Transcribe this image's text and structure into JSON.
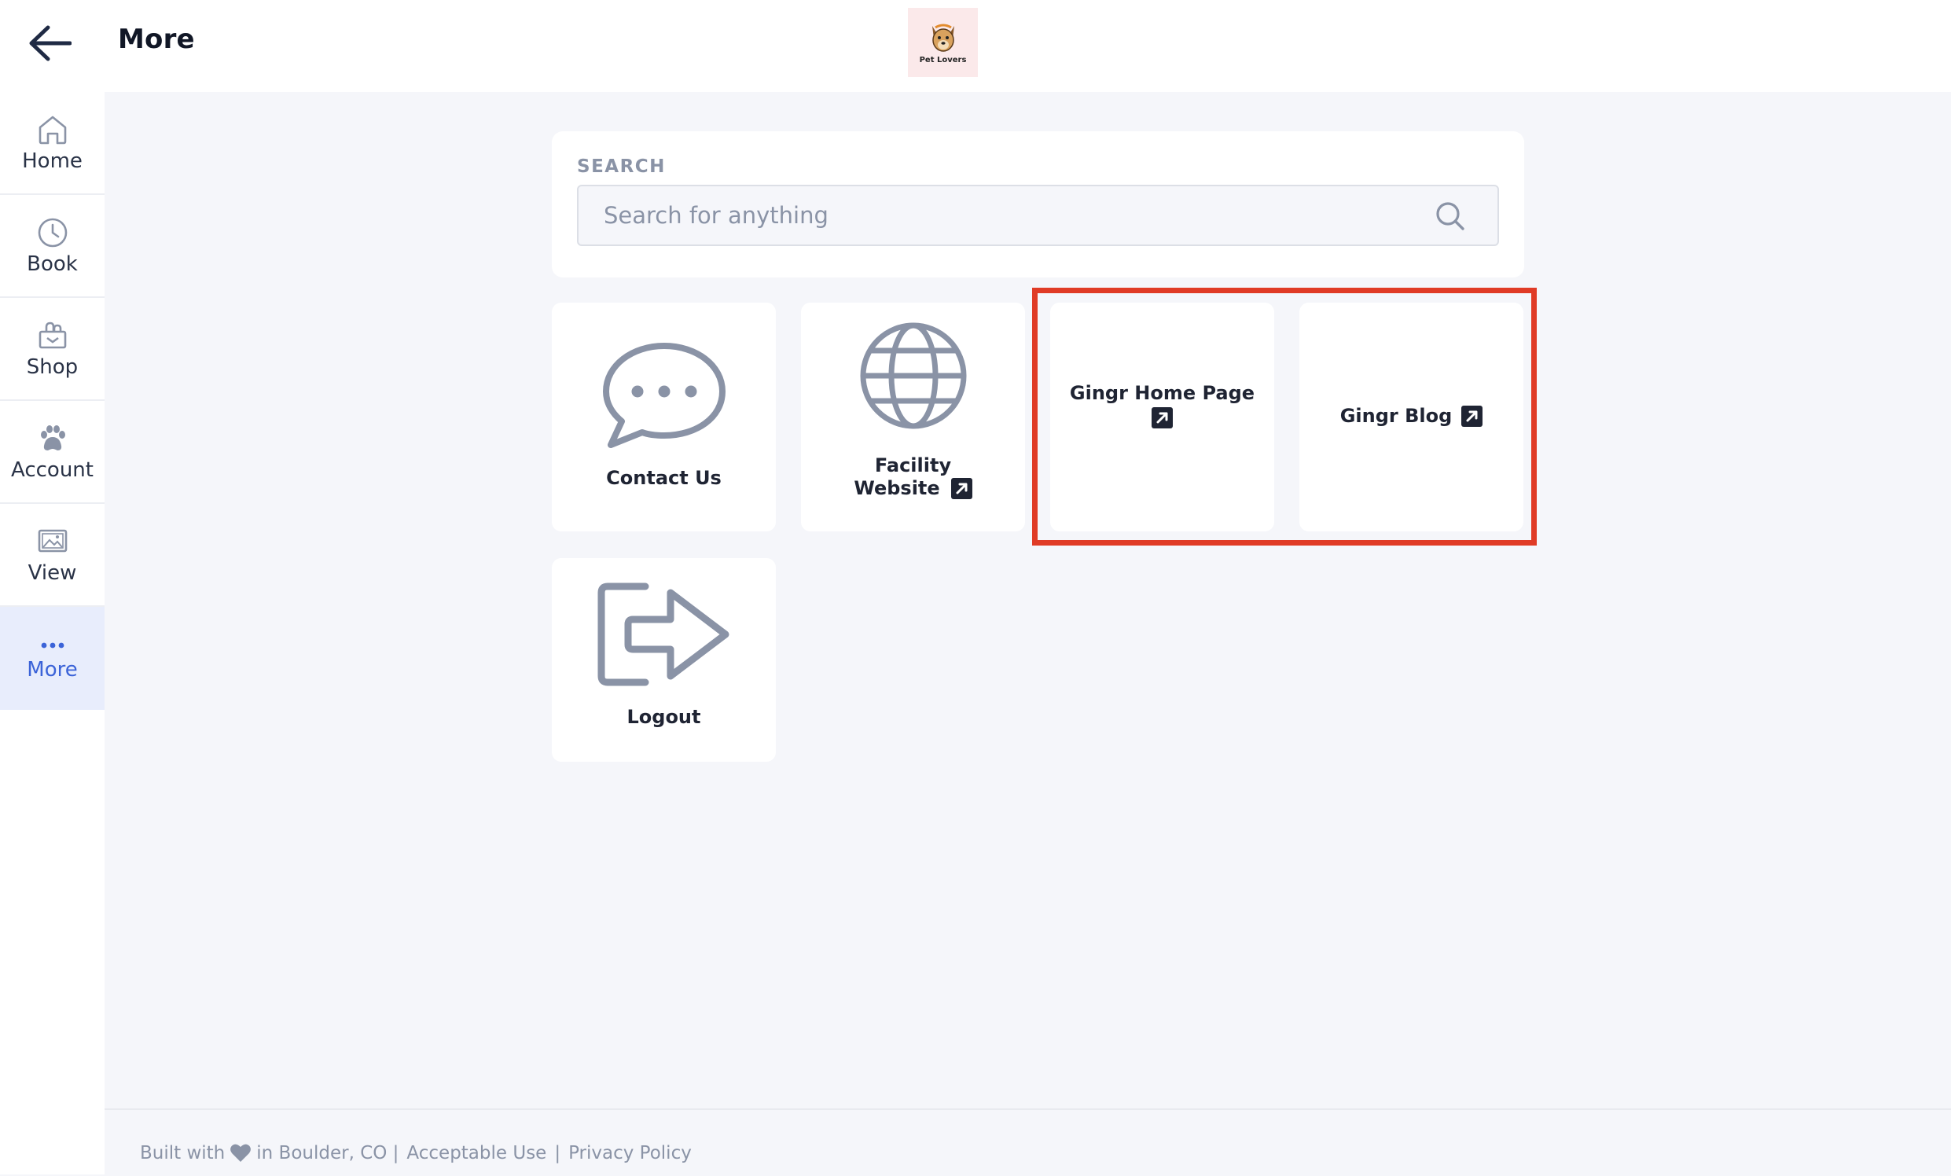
{
  "header": {
    "title": "More",
    "logo_text": "Pet Lovers"
  },
  "sidebar": {
    "items": [
      {
        "label": "Home",
        "icon": "home-icon"
      },
      {
        "label": "Book",
        "icon": "clock-icon"
      },
      {
        "label": "Shop",
        "icon": "shopping-bag-icon"
      },
      {
        "label": "Account",
        "icon": "paw-icon"
      },
      {
        "label": "View",
        "icon": "image-icon"
      },
      {
        "label": "More",
        "icon": "dots-icon",
        "active": true
      }
    ]
  },
  "search": {
    "label": "SEARCH",
    "placeholder": "Search for anything",
    "value": ""
  },
  "tiles": [
    {
      "label": "Contact Us",
      "icon": "chat-bubble-icon"
    },
    {
      "label_line1": "Facility",
      "label_line2": "Website",
      "icon": "globe-icon",
      "external": true
    },
    {
      "label": "Gingr Home Page",
      "external": true
    },
    {
      "label": "Gingr Blog",
      "external": true
    },
    {
      "label": "Logout",
      "icon": "logout-icon"
    }
  ],
  "footer": {
    "built_with": "Built with",
    "location": "in Boulder, CO |",
    "acceptable_use": "Acceptable Use",
    "separator": "|",
    "privacy_policy": "Privacy Policy"
  },
  "colors": {
    "accent": "#3b63d8",
    "highlight": "#e03b26",
    "icon_gray": "#8a93a6",
    "background": "#f5f6fa"
  }
}
